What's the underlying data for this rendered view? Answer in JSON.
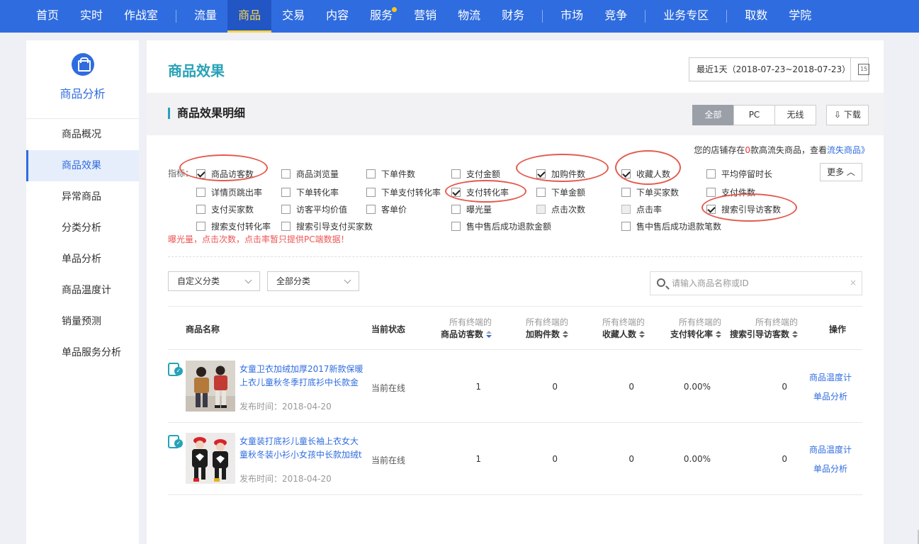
{
  "topnav": {
    "groups": [
      [
        {
          "label": "首页"
        },
        {
          "label": "实时"
        },
        {
          "label": "作战室"
        }
      ],
      [
        {
          "label": "流量"
        },
        {
          "label": "商品",
          "active": true
        },
        {
          "label": "交易"
        },
        {
          "label": "内容"
        },
        {
          "label": "服务",
          "badge": true
        },
        {
          "label": "营销"
        },
        {
          "label": "物流"
        },
        {
          "label": "财务"
        }
      ],
      [
        {
          "label": "市场"
        },
        {
          "label": "竞争"
        }
      ],
      [
        {
          "label": "业务专区"
        }
      ],
      [
        {
          "label": "取数"
        },
        {
          "label": "学院"
        }
      ]
    ]
  },
  "sidebar": {
    "title": "商品分析",
    "icon": "bag-icon",
    "items": [
      {
        "label": "商品概况"
      },
      {
        "label": "商品效果",
        "active": true
      },
      {
        "label": "异常商品"
      },
      {
        "label": "分类分析"
      },
      {
        "label": "单品分析"
      },
      {
        "label": "商品温度计"
      },
      {
        "label": "销量预测"
      },
      {
        "label": "单品服务分析"
      }
    ]
  },
  "page": {
    "title": "商品效果",
    "date_range": "最近1天（2018-07-23~2018-07-23）",
    "calendar_label": "15"
  },
  "detail": {
    "title": "商品效果明细",
    "segments": [
      "全部",
      "PC",
      "无线"
    ],
    "active_segment": "全部",
    "download_label": "下载",
    "notice": {
      "prefix": "您的店铺存在",
      "count": "0",
      "middle": "款高流失商品，查看",
      "link": "流失商品》"
    },
    "metrics_label": "指标：",
    "more_label": "更多",
    "warning": "曝光量，点击次数，点击率暂只提供PC端数据！",
    "metrics": [
      {
        "label": "商品访客数",
        "checked": true
      },
      {
        "label": "商品浏览量",
        "checked": false
      },
      {
        "label": "下单件数",
        "checked": false
      },
      {
        "label": "支付金额",
        "checked": false
      },
      {
        "label": "加购件数",
        "checked": true
      },
      {
        "label": "收藏人数",
        "checked": true
      },
      {
        "label": "平均停留时长",
        "checked": false
      },
      {
        "label": "详情页跳出率",
        "checked": false
      },
      {
        "label": "下单转化率",
        "checked": false
      },
      {
        "label": "下单支付转化率",
        "checked": false
      },
      {
        "label": "支付转化率",
        "checked": true
      },
      {
        "label": "下单金额",
        "checked": false
      },
      {
        "label": "下单买家数",
        "checked": false
      },
      {
        "label": "支付件数",
        "checked": false
      },
      {
        "label": "支付买家数",
        "checked": false
      },
      {
        "label": "访客平均价值",
        "checked": false
      },
      {
        "label": "客单价",
        "checked": false
      },
      {
        "label": "曝光量",
        "checked": false
      },
      {
        "label": "点击次数",
        "checked": false,
        "disabled": true
      },
      {
        "label": "点击率",
        "checked": false,
        "disabled": true
      },
      {
        "label": "搜索引导访客数",
        "checked": true
      },
      {
        "label": "搜索支付转化率",
        "checked": false
      },
      {
        "label": "搜索引导支付买家数",
        "checked": false
      },
      {
        "label": "售中售后成功退款金额",
        "checked": false
      },
      {
        "label": "售中售后成功退款笔数",
        "checked": false
      }
    ],
    "filters": {
      "custom_category": "自定义分类",
      "all_category": "全部分类",
      "search_placeholder": "请输入商品名称或ID"
    },
    "table": {
      "headers": {
        "name": "商品名称",
        "status": "当前状态",
        "terminal_prefix": "所有终端的",
        "visitors": "商品访客数",
        "cart": "加购件数",
        "favorites": "收藏人数",
        "conversion": "支付转化率",
        "search_visitors": "搜索引导访客数",
        "actions": "操作"
      },
      "rows": [
        {
          "name": "女童卫衣加绒加厚2017新款保暖上衣儿童秋冬季打底衫中长款金",
          "published": "发布时间：2018-04-20",
          "status": "当前在线",
          "visitors": "1",
          "cart": "0",
          "favorites": "0",
          "conversion": "0.00%",
          "search_visitors": "0",
          "op1": "商品温度计",
          "op2": "单品分析"
        },
        {
          "name": "女童装打底衫儿童长袖上衣女大童秋冬装小衫小女孩中长款加绒t",
          "published": "发布时间：2018-04-20",
          "status": "当前在线",
          "visitors": "1",
          "cart": "0",
          "favorites": "0",
          "conversion": "0.00%",
          "search_visitors": "0",
          "op1": "商品温度计",
          "op2": "单品分析"
        }
      ]
    }
  }
}
